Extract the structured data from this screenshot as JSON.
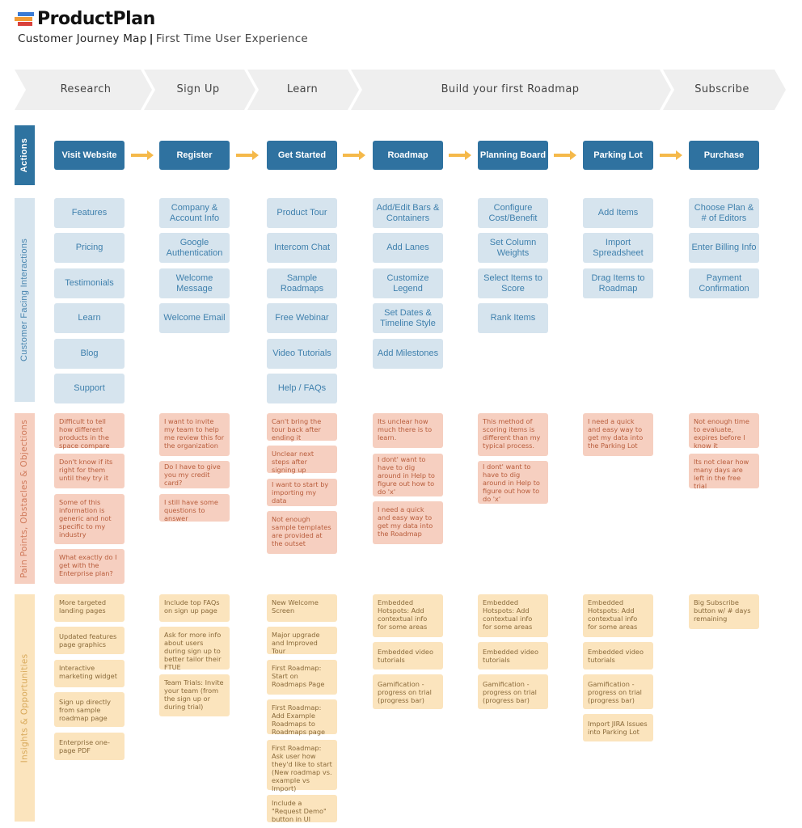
{
  "brand": {
    "logo_icon": "stacked-bars-logo-icon",
    "name": "ProductPlan",
    "colors": [
      "#3a7bd5",
      "#f29b35",
      "#d9413b"
    ]
  },
  "header": {
    "title": "Customer Journey Map",
    "separator": "|",
    "subtitle": "First Time User Experience"
  },
  "stages": [
    "Research",
    "Sign Up",
    "Learn",
    "Build your first Roadmap",
    "Subscribe"
  ],
  "rows": {
    "actions": "Actions",
    "interactions": "Customer Facing Interactions",
    "pain_points": "Pain Points, Obstacles & Objections",
    "insights": "Insights & Opportunities"
  },
  "actions": [
    "Visit Website",
    "Register",
    "Get Started",
    "Roadmap",
    "Planning Board",
    "Parking Lot",
    "Purchase"
  ],
  "arrow_icon": "right-arrow-icon",
  "interactions": [
    [
      "Features",
      "Pricing",
      "Testimonials",
      "Learn",
      "Blog",
      "Support"
    ],
    [
      "Company & Account Info",
      "Google Authentication",
      "Welcome Message",
      "Welcome Email"
    ],
    [
      "Product Tour",
      "Intercom Chat",
      "Sample Roadmaps",
      "Free Webinar",
      "Video Tutorials",
      "Help / FAQs"
    ],
    [
      "Add/Edit Bars & Containers",
      "Add Lanes",
      "Customize Legend",
      "Set Dates & Timeline Style",
      "Add Milestones"
    ],
    [
      "Configure Cost/Benefit",
      "Set Column Weights",
      "Select Items to Score",
      "Rank Items"
    ],
    [
      "Add Items",
      "Import Spreadsheet",
      "Drag Items to Roadmap"
    ],
    [
      "Choose Plan & # of Editors",
      "Enter Billing Info",
      "Payment Confirmation"
    ]
  ],
  "pain_points": [
    [
      "Difficult to tell how different products in the space compare",
      "Don't know if its right for them until they try it",
      "Some of this information is generic and not specific to my industry",
      "What exactly do I get with the Enterprise plan?"
    ],
    [
      "I want to invite my team to help me review this for the organization",
      "Do I have to give you my credit card?",
      "I still have some questions to answer"
    ],
    [
      "Can't bring the tour back after ending it",
      "Unclear next steps after signing up",
      "I want to start by importing my data",
      "Not enough sample templates are provided at the outset"
    ],
    [
      "Its unclear how much there is to learn.",
      "I dont' want to have to dig around in Help to figure out how to do 'x'",
      "I need a quick and easy way to get my data into the Roadmap"
    ],
    [
      "This method of scoring items is different than my typical process.",
      "I dont' want to have to dig around in Help to figure out how to do 'x'"
    ],
    [
      "I need a quick and easy way to get my data into the Parking Lot"
    ],
    [
      "Not enough time to evaluate, expires before I know it",
      "Its not clear how many days are left in the free trial"
    ]
  ],
  "insights": [
    [
      "More targeted landing pages",
      "Updated features page graphics",
      "Interactive marketing widget",
      "Sign up directly from sample roadmap page",
      "Enterprise one-page PDF"
    ],
    [
      "Include top FAQs on sign up page",
      "Ask for more info about users during sign up to better tailor their FTUE",
      "Team Trials: Invite your team (from the sign up or during trial)"
    ],
    [
      "New Welcome Screen",
      "Major upgrade and Improved Tour",
      "First Roadmap: Start on Roadmaps Page",
      "First Roadmap: Add Example Roadmaps to Roadmaps page",
      "First Roadmap: Ask user how they'd like to start (New roadmap vs. example vs Import)",
      "Include a \"Request Demo\" button in UI"
    ],
    [
      "Embedded Hotspots: Add contextual info for some areas",
      "Embedded video tutorials",
      "Gamification - progress on trial (progress bar)"
    ],
    [
      "Embedded Hotspots: Add contextual info for some areas",
      "Embedded video tutorials",
      "Gamification - progress on trial (progress bar)"
    ],
    [
      "Embedded Hotspots: Add contextual info for some areas",
      "Embedded video tutorials",
      "Gamification - progress on trial (progress bar)",
      "Import JIRA Issues into Parking Lot"
    ],
    [
      "Big Subscribe button w/ # days remaining"
    ]
  ],
  "colors": {
    "action_blue": "#2f72a0",
    "interaction_bg": "#d6e4ee",
    "interaction_text": "#3f80ad",
    "pain_bg": "#f6cfc0",
    "pain_text": "#b85d3c",
    "insight_bg": "#fbe4bd",
    "insight_text": "#8a6a3a",
    "arrow": "#f5b94a",
    "stage_bg": "#efefef"
  }
}
